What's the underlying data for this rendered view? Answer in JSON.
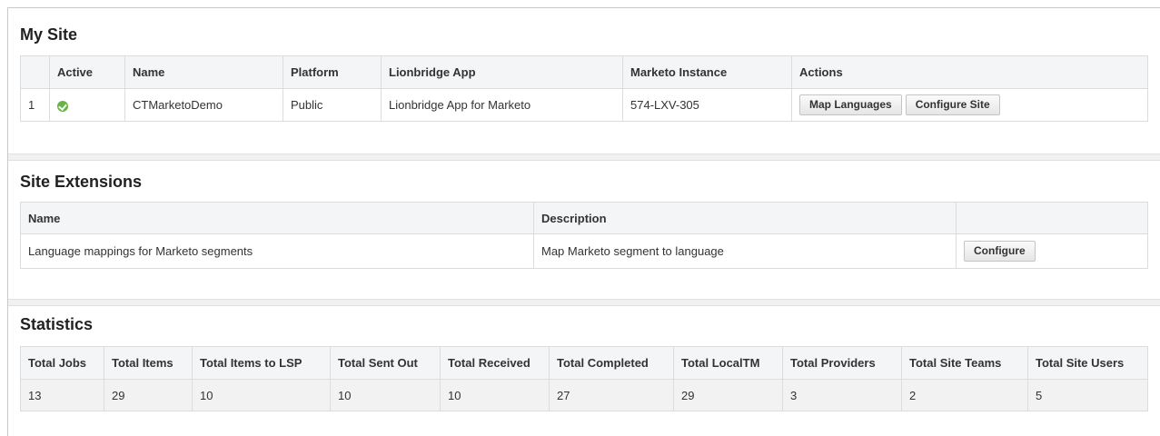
{
  "my_site": {
    "title": "My Site",
    "headers": [
      "",
      "Active",
      "Name",
      "Platform",
      "Lionbridge App",
      "Marketo Instance",
      "Actions"
    ],
    "rows": [
      {
        "index": "1",
        "active": true,
        "active_icon": "check-circle-icon",
        "name": "CTMarketoDemo",
        "platform": "Public",
        "app": "Lionbridge App for Marketo",
        "instance": "574-LXV-305",
        "actions": [
          "Map Languages",
          "Configure Site"
        ]
      }
    ]
  },
  "site_extensions": {
    "title": "Site Extensions",
    "headers": [
      "Name",
      "Description",
      ""
    ],
    "rows": [
      {
        "name": "Language mappings for Marketo segments",
        "description": "Map Marketo segment to language",
        "action": "Configure"
      }
    ]
  },
  "statistics": {
    "title": "Statistics",
    "headers": [
      "Total Jobs",
      "Total Items",
      "Total Items to LSP",
      "Total Sent Out",
      "Total Received",
      "Total Completed",
      "Total LocalTM",
      "Total Providers",
      "Total Site Teams",
      "Total Site Users"
    ],
    "values": [
      "13",
      "29",
      "10",
      "10",
      "10",
      "27",
      "29",
      "3",
      "2",
      "5"
    ]
  },
  "colors": {
    "active_green": "#67b346",
    "header_bg": "#f4f5f6",
    "border": "#dcdcdc"
  }
}
